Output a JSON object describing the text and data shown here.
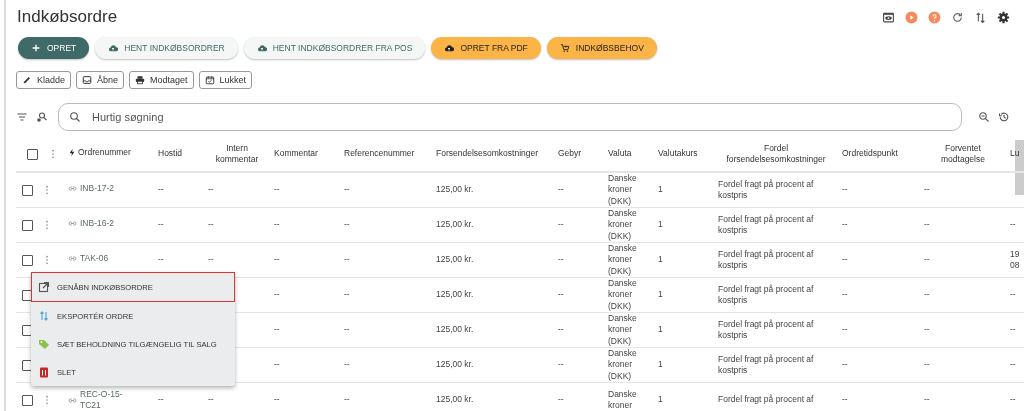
{
  "page": {
    "title": "Indkøbsordre"
  },
  "actions": [
    {
      "label": "OPRET",
      "kind": "primary"
    },
    {
      "label": "HENT INDKØBSORDRER",
      "kind": "secondary"
    },
    {
      "label": "HENT INDKØBSORDRER FRA POS",
      "kind": "secondary"
    },
    {
      "label": "OPRET FRA PDF",
      "kind": "accent"
    },
    {
      "label": "INDKØBSBEHOV",
      "kind": "accent"
    }
  ],
  "filters": [
    {
      "label": "Kladde"
    },
    {
      "label": "Åbne"
    },
    {
      "label": "Modtaget"
    },
    {
      "label": "Lukket"
    }
  ],
  "search": {
    "placeholder": "Hurtig søgning"
  },
  "table": {
    "all_checked": false,
    "columns": [
      {
        "label": "Ordrenummer"
      },
      {
        "label": "Hostid"
      },
      {
        "label": "Intern kommentar"
      },
      {
        "label": "Kommentar"
      },
      {
        "label": "Referencenummer"
      },
      {
        "label": "Forsendelsesomkostninger"
      },
      {
        "label": "Gebyr"
      },
      {
        "label": "Valuta"
      },
      {
        "label": "Valutakurs"
      },
      {
        "label": "Fordel forsendelsesomkostninger"
      },
      {
        "label": "Ordretidspunkt"
      },
      {
        "label": "Forventet modtagelse"
      },
      {
        "label": "Lu"
      }
    ],
    "rows": [
      {
        "checked": false,
        "cells": [
          "INB-17-2",
          "--",
          "--",
          "--",
          "--",
          "125,00 kr.",
          "--",
          "Danske kroner (DKK)",
          "1",
          "Fordel fragt på procent af kostpris",
          "--",
          "--",
          null
        ]
      },
      {
        "checked": false,
        "cells": [
          "INB-16-2",
          "--",
          "--",
          "--",
          "--",
          "125,00 kr.",
          "--",
          "Danske kroner (DKK)",
          "1",
          "Fordel fragt på procent af kostpris",
          "--",
          "--",
          "--"
        ]
      },
      {
        "checked": false,
        "cells": [
          "TAK-06",
          "--",
          "--",
          "--",
          "--",
          "125,00 kr.",
          "--",
          "Danske kroner (DKK)",
          "1",
          "Fordel fragt på procent af kostpris",
          "--",
          "--",
          "19\n08"
        ]
      },
      {
        "checked": false,
        "cells": [
          null,
          null,
          null,
          "--",
          "--",
          "125,00 kr.",
          "--",
          "Danske kroner (DKK)",
          "1",
          "Fordel fragt på procent af kostpris",
          "--",
          "--",
          "--"
        ]
      },
      {
        "checked": false,
        "cells": [
          null,
          null,
          null,
          "--",
          "--",
          "125,00 kr.",
          "--",
          "Danske kroner (DKK)",
          "1",
          "Fordel fragt på procent af kostpris",
          "--",
          "--",
          "--"
        ]
      },
      {
        "checked": false,
        "cells": [
          null,
          null,
          null,
          "--",
          "--",
          "125,00 kr.",
          "--",
          "Danske kroner (DKK)",
          "1",
          "Fordel fragt på procent af kostpris",
          "--",
          "--",
          "--"
        ]
      },
      {
        "checked": false,
        "cells": [
          "REC-O-15-TC21",
          "--",
          "--",
          "--",
          "--",
          "125,00 kr.",
          "--",
          "Danske kroner",
          "1",
          "Fordel fragt på procent af",
          "--",
          "--",
          "--"
        ]
      }
    ]
  },
  "row_menu": {
    "items": [
      {
        "label": "GENÅBN INDKØBSORDRE",
        "kind": "open",
        "highlighted": true
      },
      {
        "label": "EKSPORTÉR ORDRE",
        "kind": "export",
        "highlighted": false
      },
      {
        "label": "SÆT BEHOLDNING TILGÆNGELIG TIL SALG",
        "kind": "tag",
        "highlighted": false
      },
      {
        "label": "SLET",
        "kind": "delete",
        "highlighted": false
      }
    ]
  }
}
